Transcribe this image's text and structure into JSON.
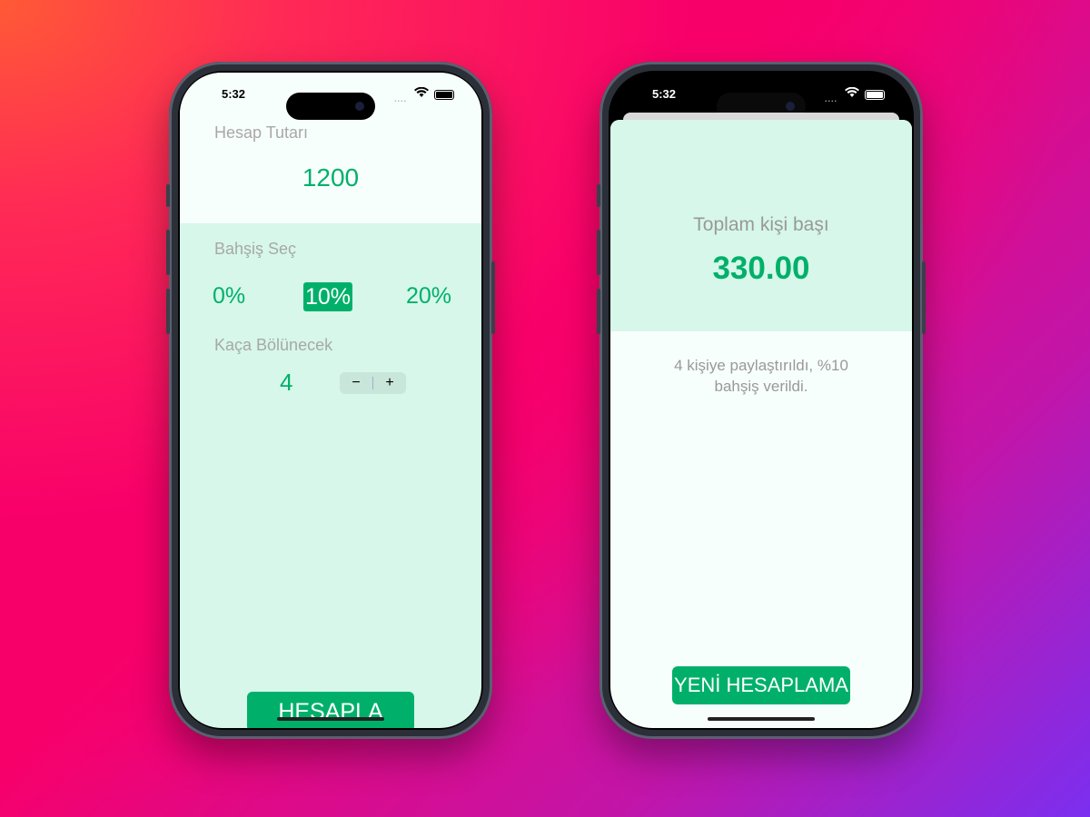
{
  "colors": {
    "accent": "#00b06a",
    "mint": "#d6f7ea",
    "white": "#f7fffc"
  },
  "left": {
    "status": {
      "time": "5:32",
      "signal": "....",
      "wifi_icon": "wifi-icon",
      "battery_icon": "battery-icon"
    },
    "bill_label": "Hesap Tutarı",
    "bill_value": "1200",
    "tip_label": "Bahşiş Seç",
    "tips": [
      {
        "label": "0%",
        "selected": false
      },
      {
        "label": "10%",
        "selected": true
      },
      {
        "label": "20%",
        "selected": false
      }
    ],
    "split_label": "Kaça Bölünecek",
    "split_value": "4",
    "stepper": {
      "minus": "−",
      "plus": "+"
    },
    "calculate_button": "HESAPLA"
  },
  "right": {
    "status": {
      "time": "5:32",
      "signal": "...."
    },
    "total_label": "Toplam kişi başı",
    "total_value": "330.00",
    "summary": "4 kişiye paylaştırıldı, %10 bahşiş verildi.",
    "recalculate_button": "YENİ HESAPLAMA"
  }
}
